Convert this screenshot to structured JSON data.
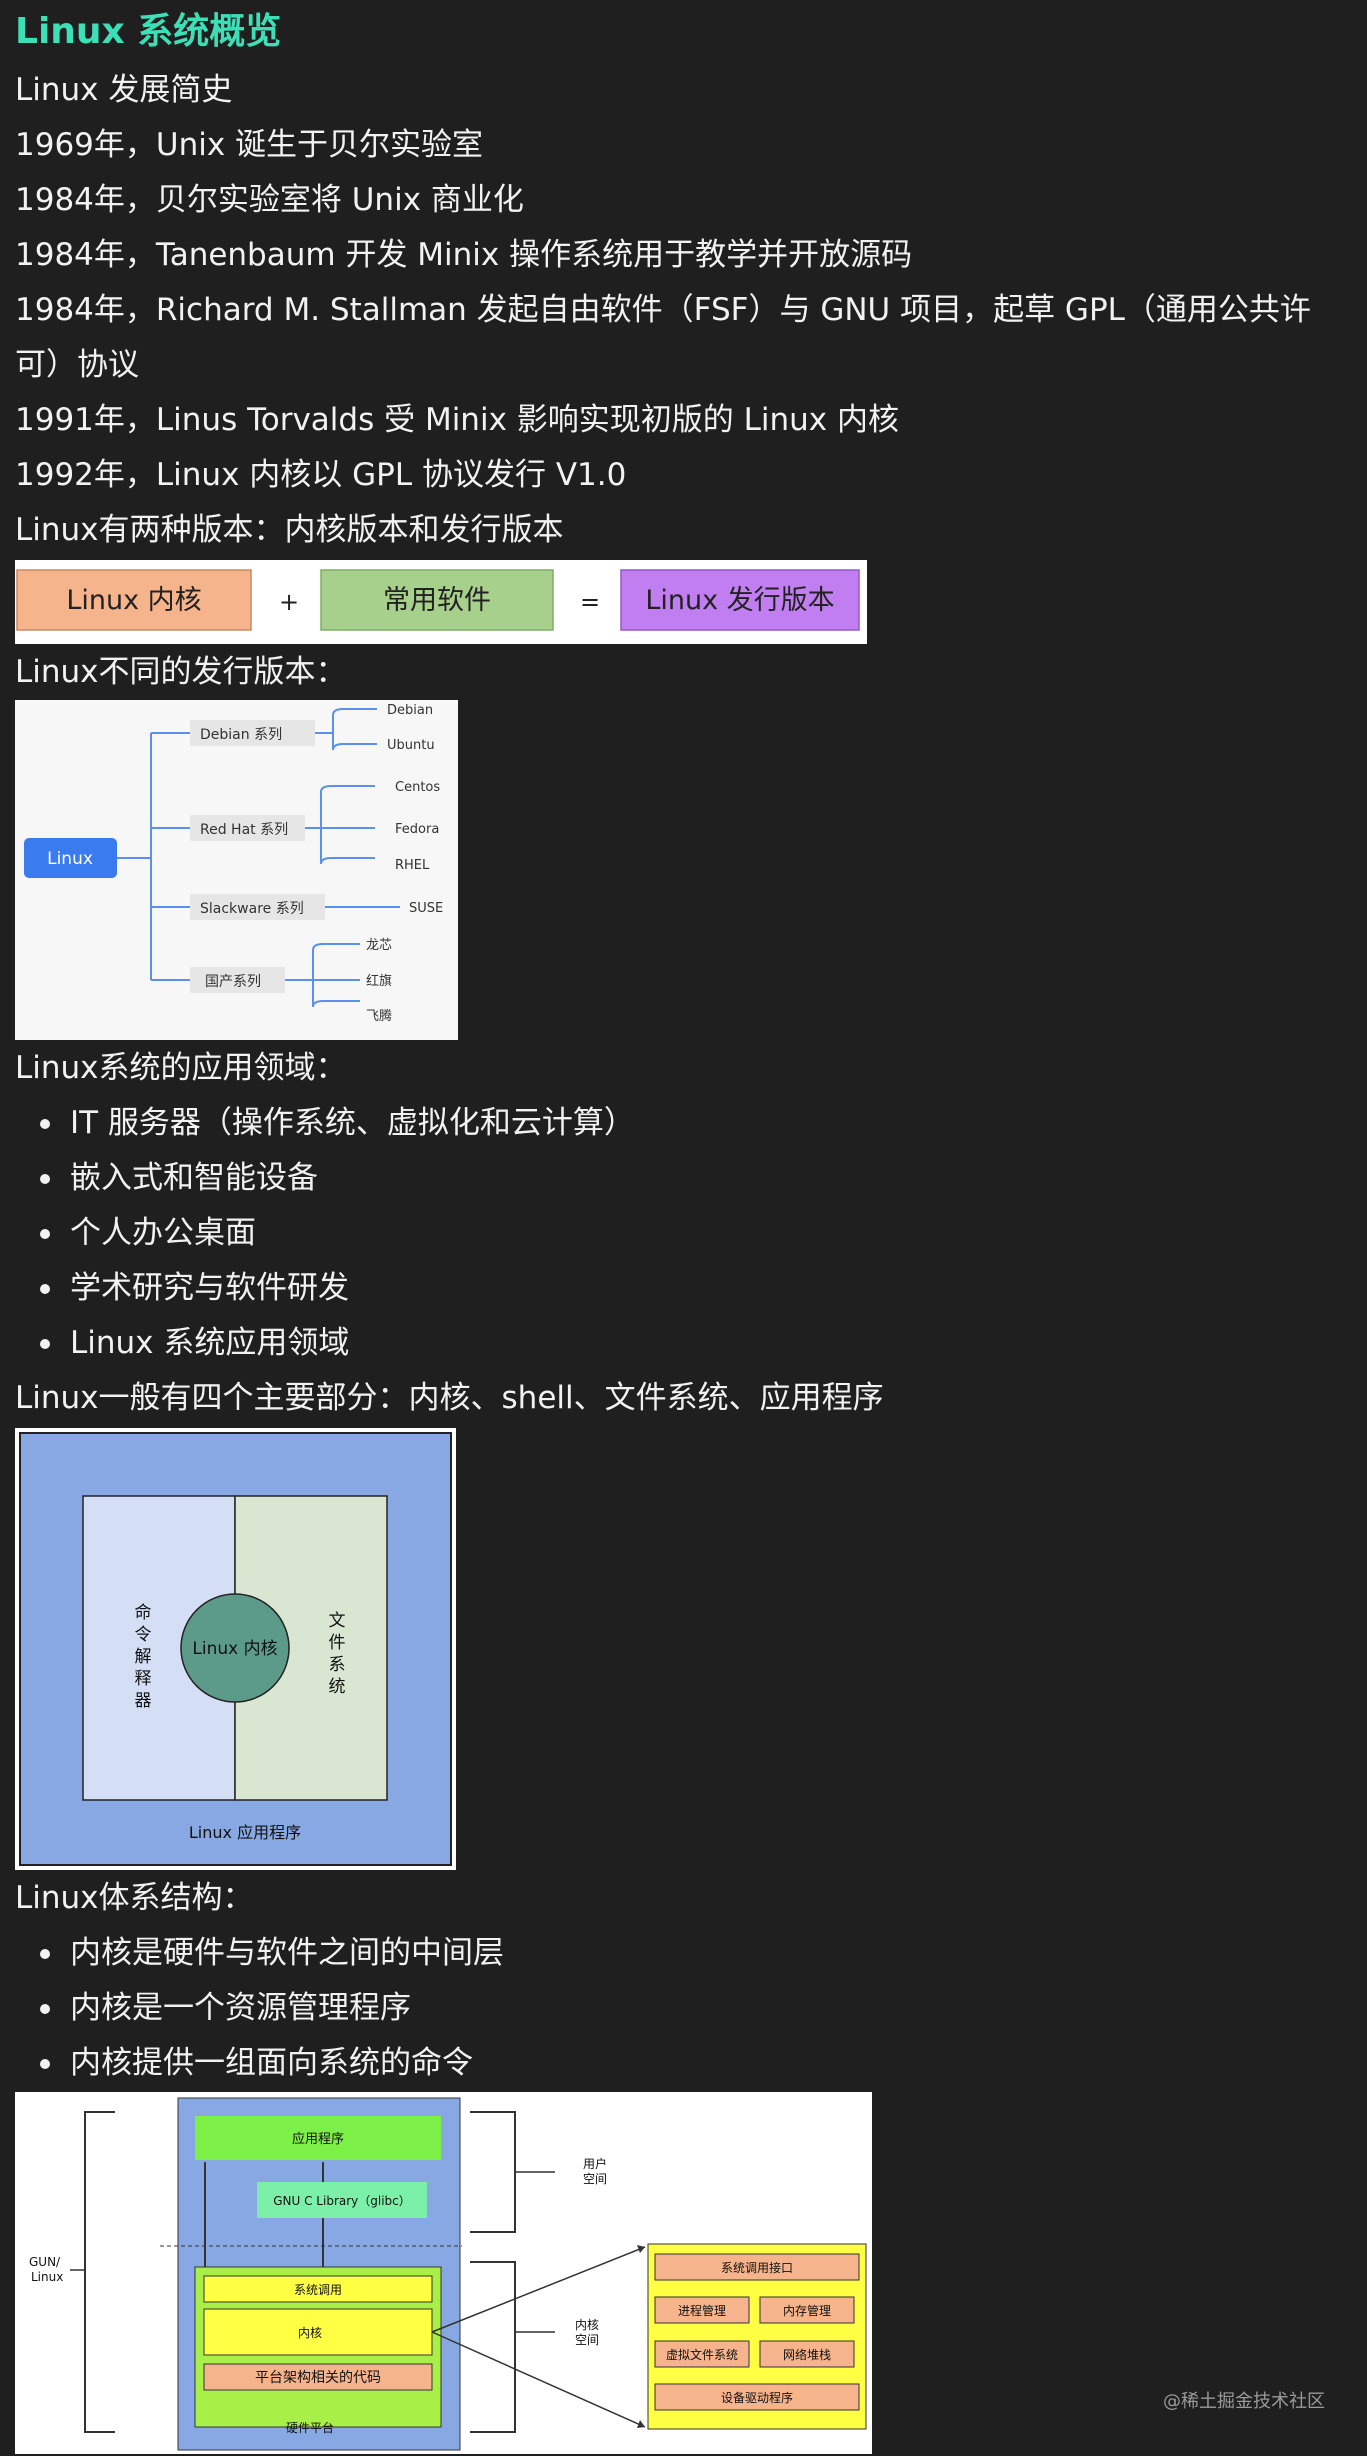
{
  "title": "Linux 系统概览",
  "history": {
    "heading": "Linux 发展简史",
    "items": [
      "1969年，Unix 诞生于贝尔实验室",
      "1984年，贝尔实验室将 Unix 商业化",
      "1984年，Tanenbaum 开发 Minix 操作系统用于教学并开放源码",
      "1984年，Richard M. Stallman 发起自由软件（FSF）与 GNU 项目，起草 GPL（通用公共许",
      "可）协议",
      "1991年，Linus Torvalds 受 Minix 影响实现初版的 Linux 内核",
      "1992年，Linux 内核以 GPL 协议发行 V1.0"
    ]
  },
  "versions": {
    "heading": "Linux有两种版本：内核版本和发行版本",
    "kernel": "Linux 内核",
    "plus": "+",
    "software": "常用软件",
    "equals": "=",
    "distro": "Linux 发行版本"
  },
  "distros": {
    "heading": "Linux不同的发行版本：",
    "root": "Linux",
    "families": [
      {
        "name": "Debian 系列",
        "members": [
          "Debian",
          "Ubuntu"
        ]
      },
      {
        "name": "Red Hat 系列",
        "members": [
          "Centos",
          "Fedora",
          "RHEL"
        ]
      },
      {
        "name": "Slackware 系列",
        "members": [
          "SUSE"
        ]
      },
      {
        "name": "国产系列",
        "members": [
          "龙芯",
          "红旗",
          "飞腾"
        ]
      }
    ]
  },
  "domains": {
    "heading": "Linux系统的应用领域：",
    "items": [
      "IT 服务器（操作系统、虚拟化和云计算）",
      "嵌入式和智能设备",
      "个人办公桌面",
      "学术研究与软件研发",
      "Linux 系统应用领域"
    ]
  },
  "parts": {
    "heading": "Linux一般有四个主要部分：内核、shell、文件系统、应用程序",
    "shell": "命令解释器",
    "kernel": "Linux 内核",
    "fs": "文件系统",
    "apps": "Linux 应用程序"
  },
  "arch": {
    "heading": "Linux体系结构：",
    "items": [
      "内核是硬件与软件之间的中间层",
      "内核是一个资源管理程序",
      "内核提供一组面向系统的命令"
    ],
    "apps": "应用程序",
    "glibc": "GNU C Library（glibc）",
    "syscall": "系统调用",
    "kernel": "内核",
    "platform": "平台架构相关的代码",
    "hardware": "硬件平台",
    "gnu": "GUN/ Linux",
    "user_space": "用户 空间",
    "kernel_space": "内核 空间",
    "detail": {
      "syscall_iface": "系统调用接口",
      "process": "进程管理",
      "memory": "内存管理",
      "vfs": "虚拟文件系统",
      "net": "网络堆栈",
      "drivers": "设备驱动程序"
    }
  },
  "watermark": "@稀土掘金技术社区",
  "colors": {
    "title": "#3ddfb6",
    "background": "#1f1f1f",
    "kernel_box": "#f6b48c",
    "software_box": "#a8d08d",
    "distro_box": "#c07ef0",
    "tree_line": "#5b8ff0",
    "root_box": "#3a7bf0"
  }
}
